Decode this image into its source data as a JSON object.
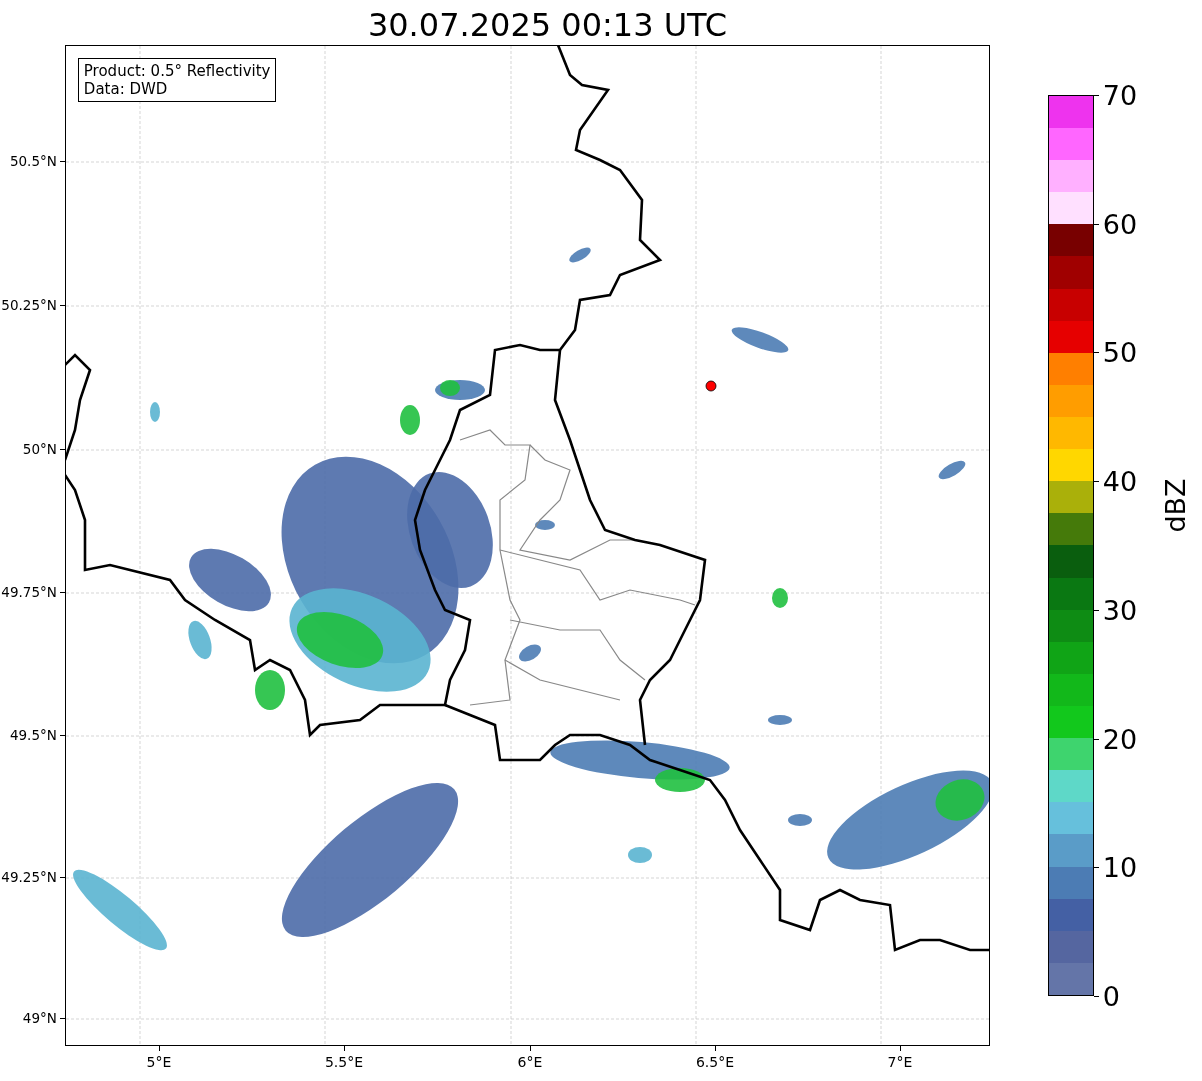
{
  "title": "30.07.2025 00:13 UTC",
  "legend": [
    "Product: 0.5° Reflectivity",
    "Data: DWD"
  ],
  "map": {
    "xticks": [
      "5°E",
      "5.5°E",
      "6°E",
      "6.5°E",
      "7°E"
    ],
    "yticks": [
      "50.5°N",
      "50.25°N",
      "50°N",
      "49.75°N",
      "49.5°N",
      "49.25°N",
      "49°N"
    ]
  },
  "colorbar": {
    "label": "dBZ",
    "ticks": [
      "70",
      "60",
      "50",
      "40",
      "30",
      "20",
      "10",
      "0"
    ]
  }
}
